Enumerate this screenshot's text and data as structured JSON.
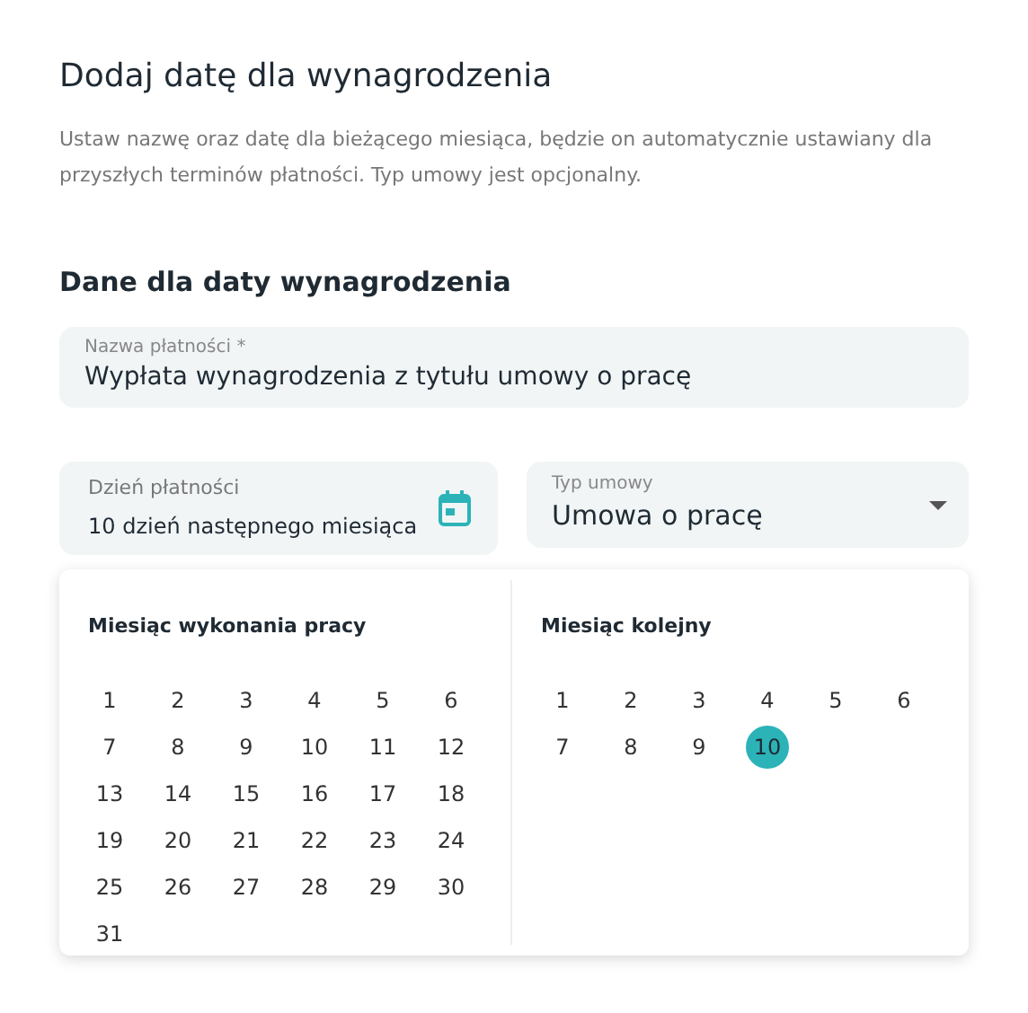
{
  "title": "Dodaj datę dla wynagrodzenia",
  "description": "Ustaw nazwę oraz datę dla bieżącego miesiąca, będzie on automatycznie ustawiany dla przyszłych terminów płatności. Typ umowy jest opcjonalny.",
  "section_title": "Dane dla daty wynagrodzenia",
  "payment_name": {
    "label": "Nazwa płatności *",
    "value": "Wypłata wynagrodzenia z tytułu umowy o pracę"
  },
  "payment_day": {
    "label": "Dzień płatności",
    "value": "10 dzień następnego miesiąca"
  },
  "contract_type": {
    "label": "Typ umowy",
    "value": "Umowa o pracę"
  },
  "calendars": [
    {
      "title": "Miesiąc wykonania pracy",
      "days": [
        {
          "label": "1",
          "selected": false
        },
        {
          "label": "2",
          "selected": false
        },
        {
          "label": "3",
          "selected": false
        },
        {
          "label": "4",
          "selected": false
        },
        {
          "label": "5",
          "selected": false
        },
        {
          "label": "6",
          "selected": false
        },
        {
          "label": "7",
          "selected": false
        },
        {
          "label": "8",
          "selected": false
        },
        {
          "label": "9",
          "selected": false
        },
        {
          "label": "10",
          "selected": false
        },
        {
          "label": "11",
          "selected": false
        },
        {
          "label": "12",
          "selected": false
        },
        {
          "label": "13",
          "selected": false
        },
        {
          "label": "14",
          "selected": false
        },
        {
          "label": "15",
          "selected": false
        },
        {
          "label": "16",
          "selected": false
        },
        {
          "label": "17",
          "selected": false
        },
        {
          "label": "18",
          "selected": false
        },
        {
          "label": "19",
          "selected": false
        },
        {
          "label": "20",
          "selected": false
        },
        {
          "label": "21",
          "selected": false
        },
        {
          "label": "22",
          "selected": false
        },
        {
          "label": "23",
          "selected": false
        },
        {
          "label": "24",
          "selected": false
        },
        {
          "label": "25",
          "selected": false
        },
        {
          "label": "26",
          "selected": false
        },
        {
          "label": "27",
          "selected": false
        },
        {
          "label": "28",
          "selected": false
        },
        {
          "label": "29",
          "selected": false
        },
        {
          "label": "30",
          "selected": false
        },
        {
          "label": "31",
          "selected": false
        }
      ]
    },
    {
      "title": "Miesiąc kolejny",
      "days": [
        {
          "label": "1",
          "selected": false
        },
        {
          "label": "2",
          "selected": false
        },
        {
          "label": "3",
          "selected": false
        },
        {
          "label": "4",
          "selected": false
        },
        {
          "label": "5",
          "selected": false
        },
        {
          "label": "6",
          "selected": false
        },
        {
          "label": "7",
          "selected": false
        },
        {
          "label": "8",
          "selected": false
        },
        {
          "label": "9",
          "selected": false
        },
        {
          "label": "10",
          "selected": true
        }
      ]
    }
  ]
}
